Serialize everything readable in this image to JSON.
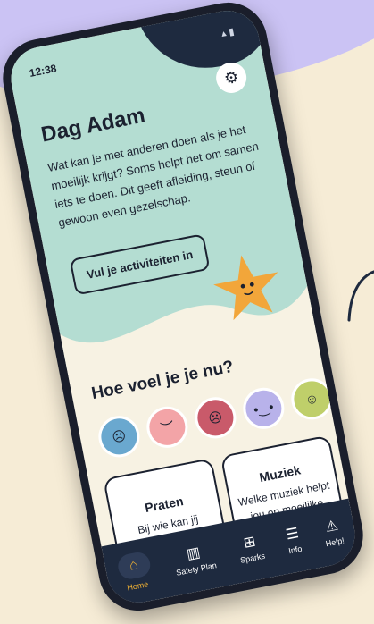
{
  "status": {
    "time": "12:38",
    "icons": "▴ ▮"
  },
  "header": {
    "greeting": "Dag Adam",
    "intro": "Wat kan je met anderen doen als je het moeilijk krijgt? Soms helpt het om samen iets te doen. Dit geeft afleiding, steun of gewoon even gezelschap.",
    "cta_label": "Vul je activiteiten in",
    "settings_icon": "gear-icon"
  },
  "mood": {
    "question": "Hoe voel je je nu?",
    "faces": [
      {
        "name": "very-sad",
        "color": "#6aa8cf"
      },
      {
        "name": "sad",
        "color": "#f3a4a7"
      },
      {
        "name": "upset",
        "color": "#c95a6a"
      },
      {
        "name": "neutral",
        "color": "#b8b2ea"
      },
      {
        "name": "happy",
        "color": "#bfcf6a"
      }
    ]
  },
  "cards": [
    {
      "title": "Praten",
      "desc": "Bij wie kan jij terecht?"
    },
    {
      "title": "Muziek",
      "desc": "Welke muziek helpt jou op moeilijke momenten?"
    }
  ],
  "nav": {
    "items": [
      {
        "label": "Home",
        "icon": "home-icon",
        "active": true
      },
      {
        "label": "Safety Plan",
        "icon": "map-icon"
      },
      {
        "label": "Sparks",
        "icon": "grid-icon"
      },
      {
        "label": "Info",
        "icon": "list-icon"
      },
      {
        "label": "Help!",
        "icon": "warning-icon"
      }
    ]
  },
  "colors": {
    "accent": "#f2b233",
    "navy": "#1e2a3f",
    "mint": "#b4ddd2"
  }
}
